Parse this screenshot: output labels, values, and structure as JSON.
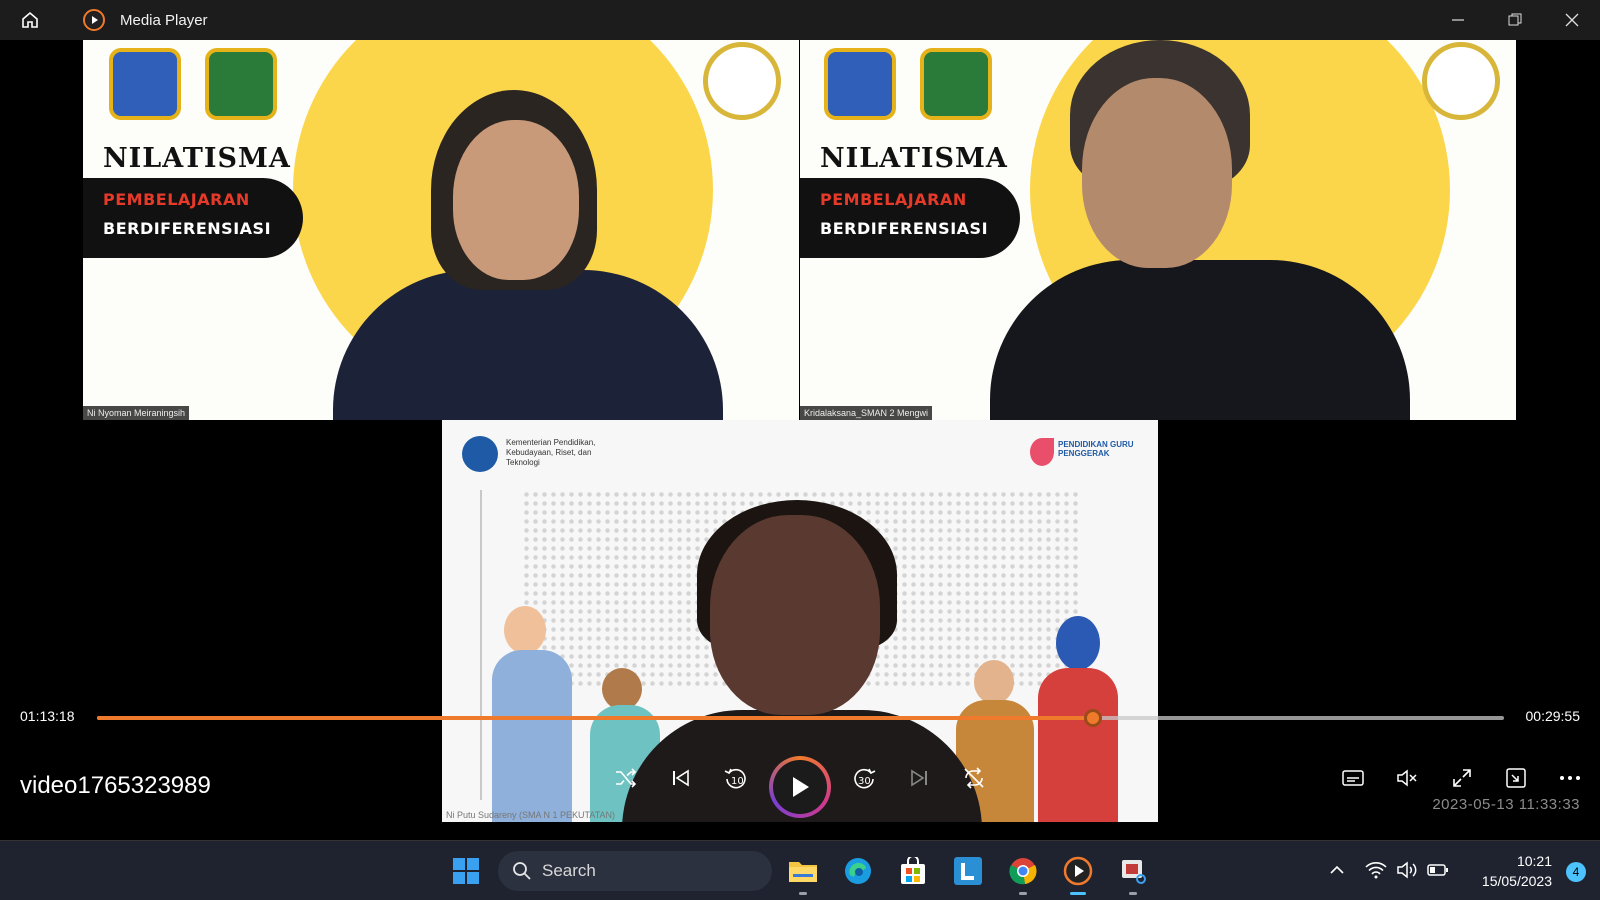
{
  "window": {
    "title": "Media Player",
    "controls": [
      "minimize",
      "restore",
      "close"
    ]
  },
  "video_frame": {
    "top_left": {
      "heading": "NILATISMA",
      "banner_line1": "PEMBELAJARAN",
      "banner_line2": "BERDIFERENSIASI",
      "participant_name": "Ni Nyoman Meiraningsih"
    },
    "top_right": {
      "heading": "NILATISMA",
      "banner_line1": "PEMBELAJARAN",
      "banner_line2": "BERDIFERENSIASI",
      "participant_name": "Kridalaksana_SMAN 2 Mengwi"
    },
    "bottom": {
      "ministry_text": "Kementerian Pendidikan, Kebudayaan, Riset, dan Teknologi",
      "program_text": "PENDIDIKAN GURU PENGGERAK",
      "participant_name": "Ni Putu Sudareny (SMA N 1 PEKUTATAN)",
      "timestamp": "2023-05-13 11:33:33"
    }
  },
  "player": {
    "current_time": "01:13:18",
    "remaining_time": "00:29:55",
    "progress": 0.708,
    "video_title": "video1765323989",
    "state": "paused",
    "buttons": [
      "shuffle",
      "previous",
      "rewind-10",
      "play",
      "forward-30",
      "next",
      "repeat-off",
      "subtitles",
      "mute",
      "fullscreen",
      "mini-player",
      "more"
    ],
    "accent_color": "#f07a2c"
  },
  "taskbar": {
    "search_placeholder": "Search",
    "clock_time": "10:21",
    "clock_date": "15/05/2023",
    "notification_count": "4",
    "pinned_apps": [
      "start",
      "search",
      "file-explorer",
      "edge",
      "microsoft-store",
      "l-app",
      "chrome",
      "media-player",
      "snipping-tool"
    ]
  }
}
